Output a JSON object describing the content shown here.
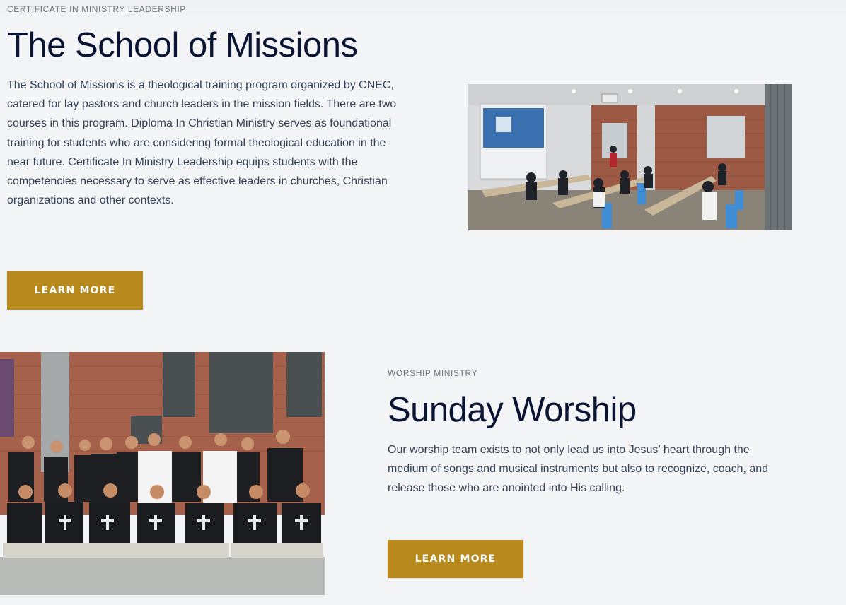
{
  "section_missions": {
    "eyebrow": "CERTIFICATE IN MINISTRY LEADERSHIP",
    "title": "The School of Missions",
    "body": "The School of Missions is a theological training program organized by CNEC, catered for lay pastors and church leaders in the mission fields. There are two courses in this program. Diploma In Christian Ministry serves as foundational training for students who are considering formal theological education in the near future. Certificate In Ministry Leadership equips students with the competencies necessary to serve as effective leaders in churches, Christian organizations and other contexts.",
    "button_label": "LEARN MORE"
  },
  "section_worship": {
    "eyebrow": "WORSHIP MINISTRY",
    "title": "Sunday Worship",
    "body": "Our worship team exists to not only lead us into Jesus’ heart through the medium of songs and musical instruments but also to recognize, coach, and release those who are anointed into His calling.",
    "button_label": "LEARN MORE"
  },
  "colors": {
    "background": "#f3f4f6",
    "heading": "#0b1433",
    "accent_button": "#b8891d",
    "eyebrow": "#6b7280"
  }
}
